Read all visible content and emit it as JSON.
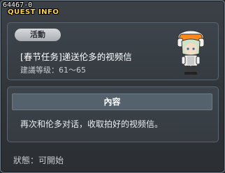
{
  "window": {
    "id": "64467-0",
    "title": "QUEST INFO"
  },
  "quest": {
    "tag": "活動",
    "name": "[春节任务]递送伦多的视频信",
    "level": "建議等级：61～65"
  },
  "content": {
    "header": "內容",
    "text": "再次和伦多对话，收取拍好的视频信。"
  },
  "status": "狀態：可開始",
  "colors": {
    "title": "#ffd24a",
    "panel_border": "#5c6670",
    "background": "#2f3439"
  },
  "icons": {
    "npc": "npc-portrait-icon"
  }
}
